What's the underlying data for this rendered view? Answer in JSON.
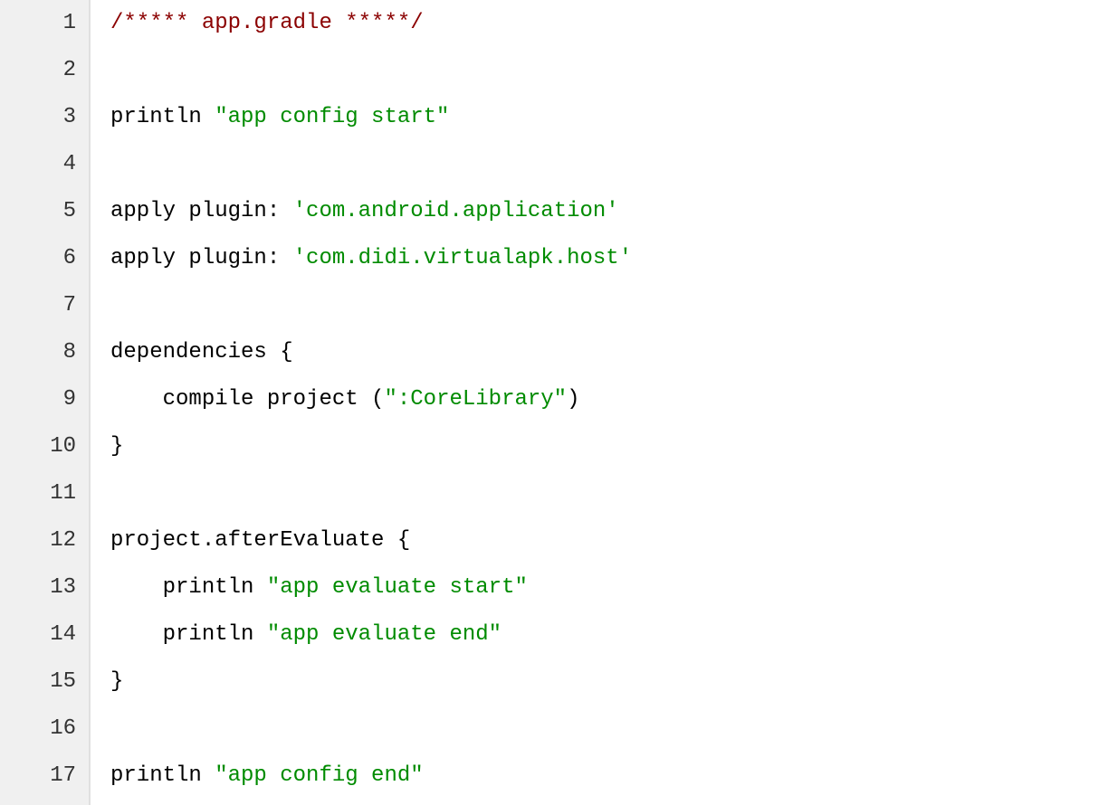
{
  "lines": [
    {
      "n": "1",
      "tokens": [
        {
          "text": "/***** app.gradle *****/",
          "cls": "tok-comment"
        }
      ]
    },
    {
      "n": "2",
      "tokens": []
    },
    {
      "n": "3",
      "tokens": [
        {
          "text": "println ",
          "cls": "tok-default"
        },
        {
          "text": "\"app config start\"",
          "cls": "tok-string"
        }
      ]
    },
    {
      "n": "4",
      "tokens": []
    },
    {
      "n": "5",
      "tokens": [
        {
          "text": "apply plugin: ",
          "cls": "tok-default"
        },
        {
          "text": "'com.android.application'",
          "cls": "tok-string"
        }
      ]
    },
    {
      "n": "6",
      "tokens": [
        {
          "text": "apply plugin: ",
          "cls": "tok-default"
        },
        {
          "text": "'com.didi.virtualapk.host'",
          "cls": "tok-string"
        }
      ]
    },
    {
      "n": "7",
      "tokens": []
    },
    {
      "n": "8",
      "tokens": [
        {
          "text": "dependencies {",
          "cls": "tok-default"
        }
      ]
    },
    {
      "n": "9",
      "tokens": [
        {
          "text": "    compile project (",
          "cls": "tok-default"
        },
        {
          "text": "\":CoreLibrary\"",
          "cls": "tok-string"
        },
        {
          "text": ")",
          "cls": "tok-default"
        }
      ]
    },
    {
      "n": "10",
      "tokens": [
        {
          "text": "}",
          "cls": "tok-default"
        }
      ]
    },
    {
      "n": "11",
      "tokens": []
    },
    {
      "n": "12",
      "tokens": [
        {
          "text": "project.afterEvaluate {",
          "cls": "tok-default"
        }
      ]
    },
    {
      "n": "13",
      "tokens": [
        {
          "text": "    println ",
          "cls": "tok-default"
        },
        {
          "text": "\"app evaluate start\"",
          "cls": "tok-string"
        }
      ]
    },
    {
      "n": "14",
      "tokens": [
        {
          "text": "    println ",
          "cls": "tok-default"
        },
        {
          "text": "\"app evaluate end\"",
          "cls": "tok-string"
        }
      ]
    },
    {
      "n": "15",
      "tokens": [
        {
          "text": "}",
          "cls": "tok-default"
        }
      ]
    },
    {
      "n": "16",
      "tokens": []
    },
    {
      "n": "17",
      "tokens": [
        {
          "text": "println ",
          "cls": "tok-default"
        },
        {
          "text": "\"app config end\"",
          "cls": "tok-string"
        }
      ]
    }
  ]
}
